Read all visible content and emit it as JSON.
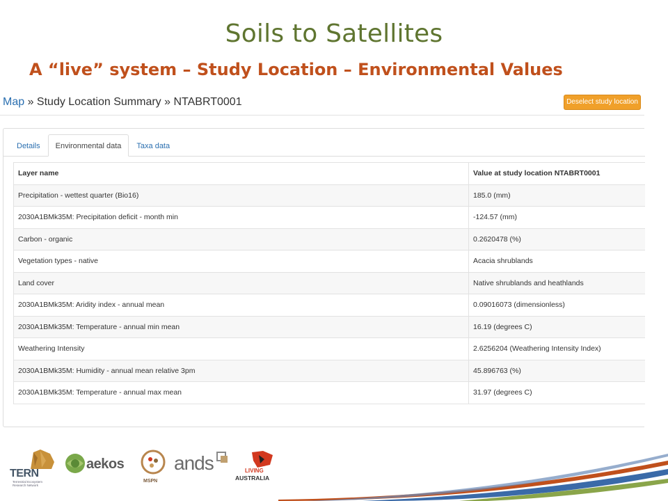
{
  "slide": {
    "title": "Soils to Satellites",
    "subtitle": "A “live” system – Study Location – Environmental Values"
  },
  "breadcrumb": {
    "map": "Map",
    "sep1": " » ",
    "summary": "Study Location Summary",
    "sep2": " » ",
    "current": "NTABRT0001"
  },
  "deselect_button": "Deselect study location",
  "tabs": [
    {
      "label": "Details",
      "active": false
    },
    {
      "label": "Environmental data",
      "active": true
    },
    {
      "label": "Taxa data",
      "active": false
    }
  ],
  "table": {
    "headers": [
      "Layer name",
      "Value at study location NTABRT0001"
    ],
    "rows": [
      [
        "Precipitation - wettest quarter (Bio16)",
        "185.0 (mm)"
      ],
      [
        "2030A1BMk35M: Precipitation deficit - month min",
        "-124.57 (mm)"
      ],
      [
        "Carbon - organic",
        "0.2620478 (%)"
      ],
      [
        "Vegetation types - native",
        "Acacia shrublands"
      ],
      [
        "Land cover",
        "Native shrublands and heathlands"
      ],
      [
        "2030A1BMk35M: Aridity index - annual mean",
        "0.09016073 (dimensionless)"
      ],
      [
        "2030A1BMk35M: Temperature - annual min mean",
        "16.19 (degrees C)"
      ],
      [
        "Weathering Intensity",
        "2.6256204 (Weathering Intensity Index)"
      ],
      [
        "2030A1BMk35M: Humidity - annual mean relative 3pm",
        "45.896763 (%)"
      ],
      [
        "2030A1BMk35M: Temperature - annual max mean",
        "31.97 (degrees C)"
      ]
    ]
  },
  "logos": {
    "tern": "TERN",
    "tern_sub": "Terrestrial Ecosystem Research Network",
    "aekos": "aekos",
    "mspn": "MSPN",
    "ands": "ands",
    "ala_living": "LIVING",
    "ala": "AUSTRALIA"
  },
  "colors": {
    "title": "#5f7530",
    "subtitle": "#c0501c",
    "link": "#2a6fb0",
    "button": "#f0a02a"
  }
}
